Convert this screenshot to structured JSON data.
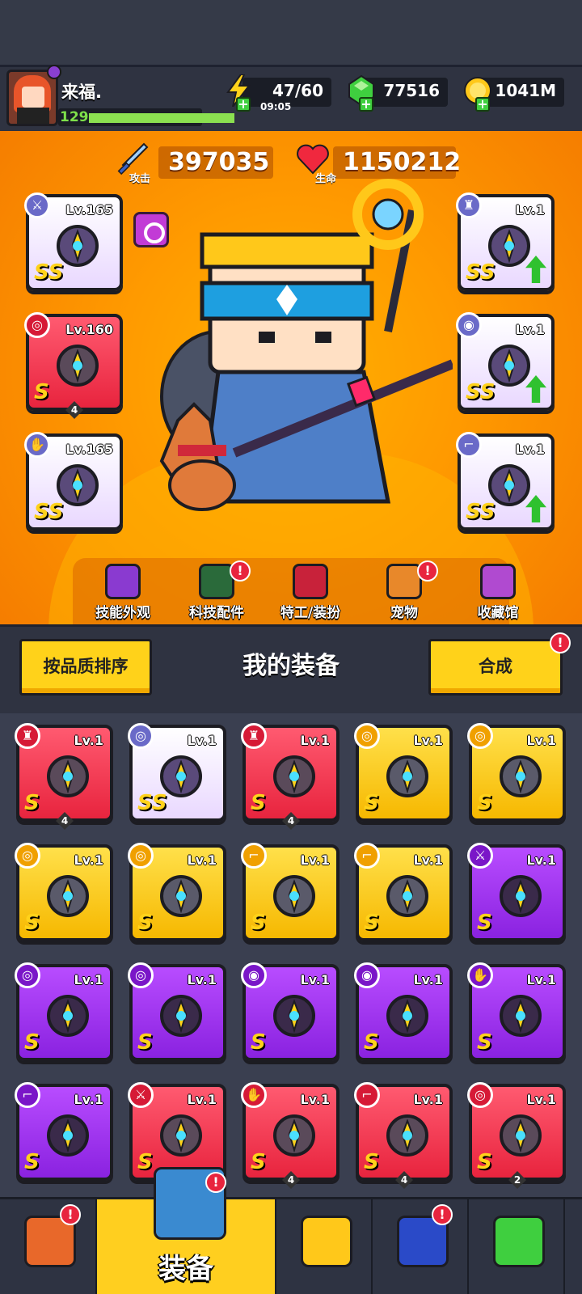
{
  "player": {
    "name": "来福.",
    "level": "129",
    "level_progress": 1.0
  },
  "resources": {
    "energy": "47/60",
    "energy_timer": "09:05",
    "gems": "77516",
    "coins": "1041M"
  },
  "stats": {
    "attack_label": "攻击",
    "attack_value": "397035",
    "hp_label": "生命",
    "hp_value": "1150212"
  },
  "equipped_left": [
    {
      "type_icon": "weapon-icon",
      "level": "Lv.165",
      "grade": "SS",
      "quality": "pink",
      "item_icon": "staff-icon",
      "stars": ""
    },
    {
      "type_icon": "necklace-icon",
      "level": "Lv.160",
      "grade": "S",
      "quality": "red",
      "item_icon": "chain-necklace-icon",
      "stars": "4"
    },
    {
      "type_icon": "glove-icon",
      "level": "Lv.165",
      "grade": "SS",
      "quality": "pink",
      "item_icon": "gauntlet-icon",
      "stars": ""
    }
  ],
  "equipped_right": [
    {
      "type_icon": "armor-icon",
      "level": "Lv.1",
      "grade": "SS",
      "quality": "pink",
      "item_icon": "chest-armor-icon",
      "upgrade": true
    },
    {
      "type_icon": "belt-icon",
      "level": "Lv.1",
      "grade": "SS",
      "quality": "pink",
      "item_icon": "gem-belt-icon",
      "upgrade": true
    },
    {
      "type_icon": "boot-icon",
      "level": "Lv.1",
      "grade": "SS",
      "quality": "pink",
      "item_icon": "winged-boot-icon",
      "upgrade": true
    }
  ],
  "menu": [
    {
      "label": "技能外观",
      "icon": "skin-hat-icon",
      "alert": false
    },
    {
      "label": "科技配件",
      "icon": "tech-part-icon",
      "alert": true
    },
    {
      "label": "特工/装扮",
      "icon": "agent-icon",
      "alert": false
    },
    {
      "label": "宠物",
      "icon": "dog-icon",
      "alert": true
    },
    {
      "label": "收藏馆",
      "icon": "collection-chest-icon",
      "alert": false
    }
  ],
  "equipment_panel": {
    "sort_button": "按品质排序",
    "title": "我的装备",
    "merge_button": "合成",
    "alert_mark": "!"
  },
  "inventory": [
    {
      "level": "Lv.1",
      "grade": "S",
      "quality": "red",
      "type_icon": "armor-icon",
      "item_icon": "shoulder-armor-icon",
      "stars": "4"
    },
    {
      "level": "Lv.1",
      "grade": "SS",
      "quality": "pink",
      "type_icon": "necklace-icon",
      "item_icon": "star-collar-icon",
      "stars": ""
    },
    {
      "level": "Lv.1",
      "grade": "S",
      "quality": "red",
      "type_icon": "armor-icon",
      "item_icon": "mech-armor-icon",
      "stars": "4"
    },
    {
      "level": "Lv.1",
      "grade": "S",
      "quality": "yellow",
      "type_icon": "necklace-icon",
      "item_icon": "star-ring-icon",
      "stars": ""
    },
    {
      "level": "Lv.1",
      "grade": "S",
      "quality": "yellow",
      "type_icon": "necklace-icon",
      "item_icon": "star-ring-icon",
      "stars": ""
    },
    {
      "level": "Lv.1",
      "grade": "S",
      "quality": "yellow",
      "type_icon": "necklace-icon",
      "item_icon": "star-ring-icon",
      "stars": ""
    },
    {
      "level": "Lv.1",
      "grade": "S",
      "quality": "yellow",
      "type_icon": "necklace-icon",
      "item_icon": "star-ring-icon",
      "stars": ""
    },
    {
      "level": "Lv.1",
      "grade": "S",
      "quality": "yellow",
      "type_icon": "boot-icon",
      "item_icon": "dark-boot-icon",
      "stars": ""
    },
    {
      "level": "Lv.1",
      "grade": "S",
      "quality": "yellow",
      "type_icon": "boot-icon",
      "item_icon": "dark-boot-icon",
      "stars": ""
    },
    {
      "level": "Lv.1",
      "grade": "S",
      "quality": "purple",
      "type_icon": "weapon-icon",
      "item_icon": "blaster-icon",
      "stars": ""
    },
    {
      "level": "Lv.1",
      "grade": "S",
      "quality": "purple",
      "type_icon": "necklace-icon",
      "item_icon": "spiked-necklace-icon",
      "stars": ""
    },
    {
      "level": "Lv.1",
      "grade": "S",
      "quality": "purple",
      "type_icon": "necklace-icon",
      "item_icon": "spiked-necklace-icon",
      "stars": ""
    },
    {
      "level": "Lv.1",
      "grade": "S",
      "quality": "purple",
      "type_icon": "belt-icon",
      "item_icon": "gem-belt-icon",
      "stars": ""
    },
    {
      "level": "Lv.1",
      "grade": "S",
      "quality": "purple",
      "type_icon": "belt-icon",
      "item_icon": "orb-belt-icon",
      "stars": ""
    },
    {
      "level": "Lv.1",
      "grade": "S",
      "quality": "purple",
      "type_icon": "glove-icon",
      "item_icon": "gauntlet-icon",
      "stars": ""
    },
    {
      "level": "Lv.1",
      "grade": "S",
      "quality": "purple",
      "type_icon": "boot-icon",
      "item_icon": "dark-boot-icon",
      "stars": ""
    },
    {
      "level": "Lv.1",
      "grade": "S",
      "quality": "red",
      "type_icon": "weapon-icon",
      "item_icon": "kunai-icon",
      "stars": ""
    },
    {
      "level": "Lv.1",
      "grade": "S",
      "quality": "red",
      "type_icon": "glove-icon",
      "item_icon": "gem-gauntlet-icon",
      "stars": "4"
    },
    {
      "level": "Lv.1",
      "grade": "S",
      "quality": "red",
      "type_icon": "boot-icon",
      "item_icon": "tech-boot-icon",
      "stars": "4"
    },
    {
      "level": "Lv.1",
      "grade": "S",
      "quality": "red",
      "type_icon": "necklace-icon",
      "item_icon": "spiked-collar-icon",
      "stars": "2"
    }
  ],
  "nav": [
    {
      "label": "",
      "icon": "shop-icon",
      "alert": true
    },
    {
      "label": "装备",
      "icon": "equipment-icon",
      "alert": true,
      "active": true
    },
    {
      "label": "",
      "icon": "battle-star-icon",
      "alert": false
    },
    {
      "label": "",
      "icon": "talent-ball-icon",
      "alert": true
    },
    {
      "label": "",
      "icon": "dna-capsule-icon",
      "alert": false
    }
  ],
  "colors": {
    "pink": "#efe2ff",
    "red": "#f03a50",
    "yellow": "#ffd21a",
    "purple": "#a23cf2",
    "accent": "#ffd21a"
  }
}
